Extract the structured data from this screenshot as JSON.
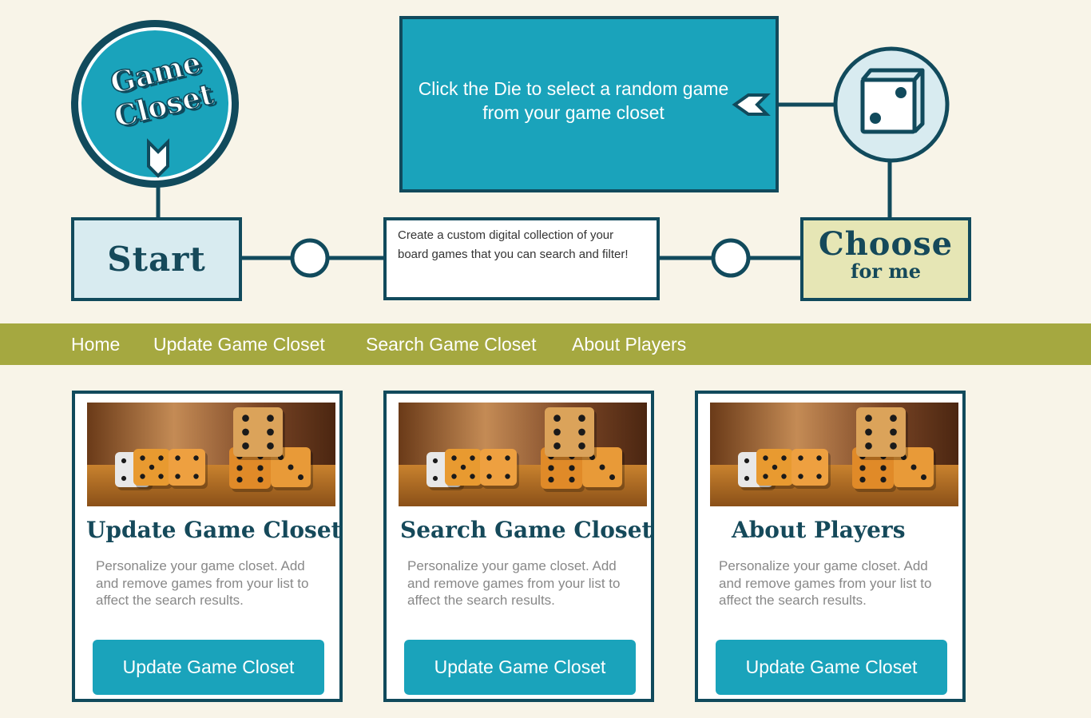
{
  "logo": {
    "line1": "Game",
    "line2": "Closet"
  },
  "start_label": "Start",
  "description": "Create a custom digital collection of your board games that you can search and filter!",
  "random_prompt": "Click the Die to select a random game from your game closet",
  "choose": {
    "line1": "Choose",
    "line2": "for me"
  },
  "nav": {
    "items": [
      {
        "label": "Home"
      },
      {
        "label": "Update Game Closet"
      },
      {
        "label": "Search Game Closet"
      },
      {
        "label": "About Players"
      }
    ]
  },
  "cards": [
    {
      "title": "Update Game Closet",
      "description": "Personalize your game closet. Add and remove games from your list to affect the search results.",
      "button": "Update Game Closet"
    },
    {
      "title": "Search Game Closet",
      "description": "Personalize your game closet. Add and remove games from your list to affect the search results.",
      "button": "Update Game Closet"
    },
    {
      "title": "About Players",
      "description": "Personalize your game closet. Add and remove games from your list to affect the search results.",
      "button": "Update Game Closet"
    }
  ],
  "colors": {
    "background": "#f8f4e8",
    "dark_teal": "#114a5c",
    "teal": "#1aa3bb",
    "pale_blue": "#d8ebf0",
    "pale_yellow": "#e6e6b5",
    "olive": "#a5a840"
  },
  "icons": {
    "die": "die-icon",
    "arrow": "arrow-left-icon"
  }
}
